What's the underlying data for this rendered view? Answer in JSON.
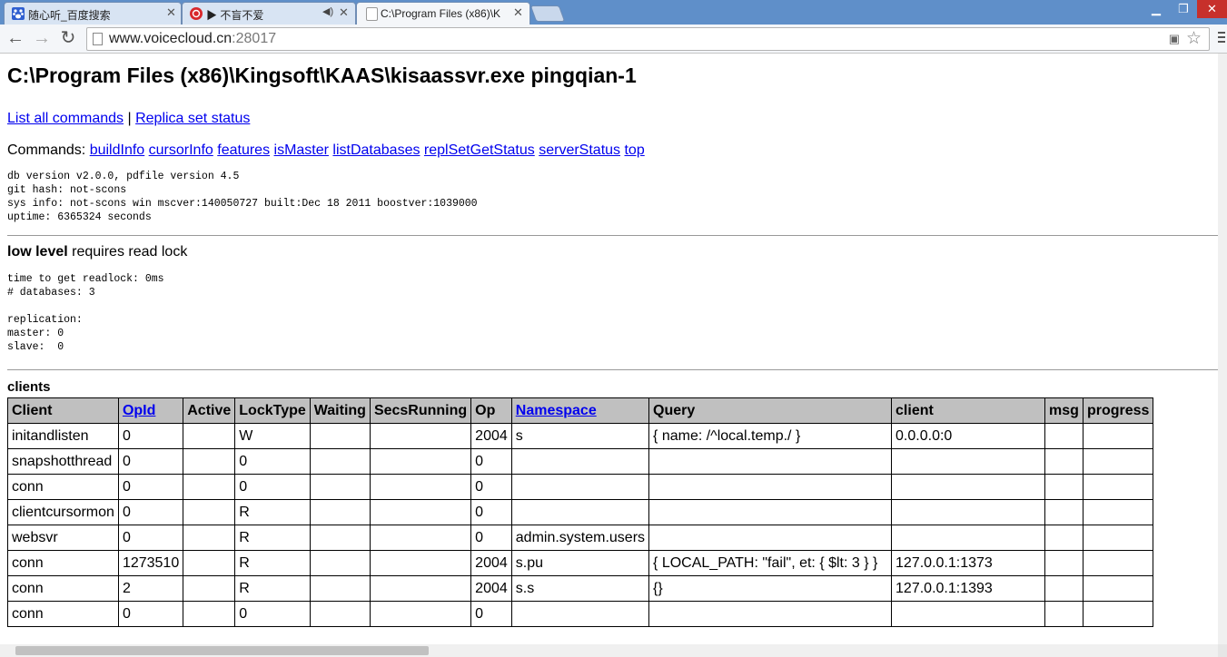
{
  "tabs": [
    {
      "title": "随心听_百度搜索",
      "icon": "baidu-paw-icon",
      "color": "#2f5fd0"
    },
    {
      "title": "▶ 不盲不爱",
      "icon": "netease-music-icon",
      "color": "#d8282b"
    },
    {
      "title": "C:\\Program Files (x86)\\K",
      "icon": "page-icon",
      "color": "#ffffff"
    }
  ],
  "address": {
    "host": "www.voicecloud.cn",
    "port": ":28017"
  },
  "page": {
    "title": "C:\\Program Files (x86)\\Kingsoft\\KAAS\\kisaassvr.exe pingqian-1",
    "link1": "List all commands",
    "sep": " | ",
    "link2": "Replica set status",
    "commands_label": "Commands:",
    "commands": [
      "buildInfo",
      "cursorInfo",
      "features",
      "isMaster",
      "listDatabases",
      "replSetGetStatus",
      "serverStatus",
      "top"
    ],
    "info": "db version v2.0.0, pdfile version 4.5\ngit hash: not-scons\nsys info: not-scons win mscver:140050727 built:Dec 18 2011 boostver:1039000\nuptime: 6365324 seconds",
    "low_level_bold": "low level",
    "low_level_rest": " requires read lock",
    "low_level_info": "time to get readlock: 0ms\n# databases: 3\n\nreplication:\nmaster: 0\nslave:  0",
    "clients_heading": "clients"
  },
  "clients_table": {
    "columns": [
      "Client",
      "OpId",
      "Active",
      "LockType",
      "Waiting",
      "SecsRunning",
      "Op",
      "Namespace",
      "Query",
      "client",
      "msg",
      "progress"
    ],
    "rows": [
      [
        "initandlisten",
        "0",
        "",
        "W",
        "",
        "",
        "2004",
        "s",
        "{ name: /^local.temp./ }",
        "0.0.0.0:0",
        "",
        ""
      ],
      [
        "snapshotthread",
        "0",
        "",
        "0",
        "",
        "",
        "0",
        "",
        "",
        "",
        "",
        ""
      ],
      [
        "conn",
        "0",
        "",
        "0",
        "",
        "",
        "0",
        "",
        "",
        "",
        "",
        ""
      ],
      [
        "clientcursormon",
        "0",
        "",
        "R",
        "",
        "",
        "0",
        "",
        "",
        "",
        "",
        ""
      ],
      [
        "websvr",
        "0",
        "",
        "R",
        "",
        "",
        "0",
        "admin.system.users",
        "",
        "",
        "",
        ""
      ],
      [
        "conn",
        "1273510",
        "",
        "R",
        "",
        "",
        "2004",
        "s.pu",
        "{ LOCAL_PATH: \"fail\", et: { $lt: 3 } }",
        "127.0.0.1:1373",
        "",
        ""
      ],
      [
        "conn",
        "2",
        "",
        "R",
        "",
        "",
        "2004",
        "s.s",
        "{}",
        "127.0.0.1:1393",
        "",
        ""
      ],
      [
        "conn",
        "0",
        "",
        "0",
        "",
        "",
        "0",
        "",
        "",
        "",
        "",
        ""
      ]
    ]
  }
}
